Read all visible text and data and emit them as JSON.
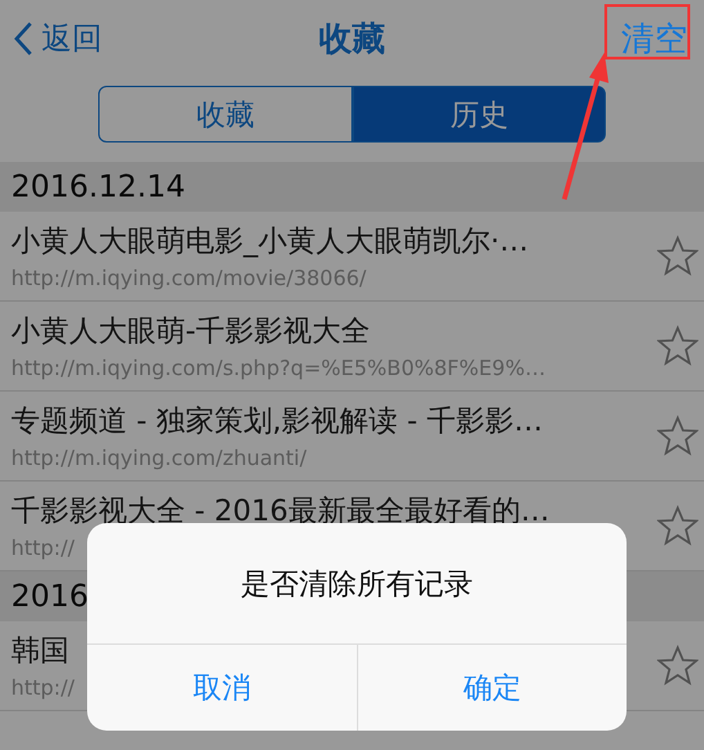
{
  "nav": {
    "back": "返回",
    "title": "收藏",
    "action": "清空"
  },
  "segments": [
    {
      "label": "收藏",
      "selected": false
    },
    {
      "label": "历史",
      "selected": true
    }
  ],
  "sections": [
    {
      "date": "2016.12.14",
      "items": [
        {
          "title": "小黄人大眼萌电影_小黄人大眼萌凯尔·…",
          "url": "http://m.iqying.com/movie/38066/"
        },
        {
          "title": "小黄人大眼萌-千影影视大全",
          "url": "http://m.iqying.com/s.php?q=%E5%B0%8F%E9%…"
        },
        {
          "title": "专题频道 - 独家策划,影视解读 - 千影影…",
          "url": "http://m.iqying.com/zhuanti/"
        },
        {
          "title": "千影影视大全 - 2016最新最全最好看的…",
          "url": "http://"
        }
      ]
    },
    {
      "date": "2016",
      "items": [
        {
          "title": "韩国",
          "url": "http://"
        }
      ]
    }
  ],
  "dialog": {
    "message": "是否清除所有记录",
    "buttons": [
      "取消",
      "确定"
    ]
  }
}
